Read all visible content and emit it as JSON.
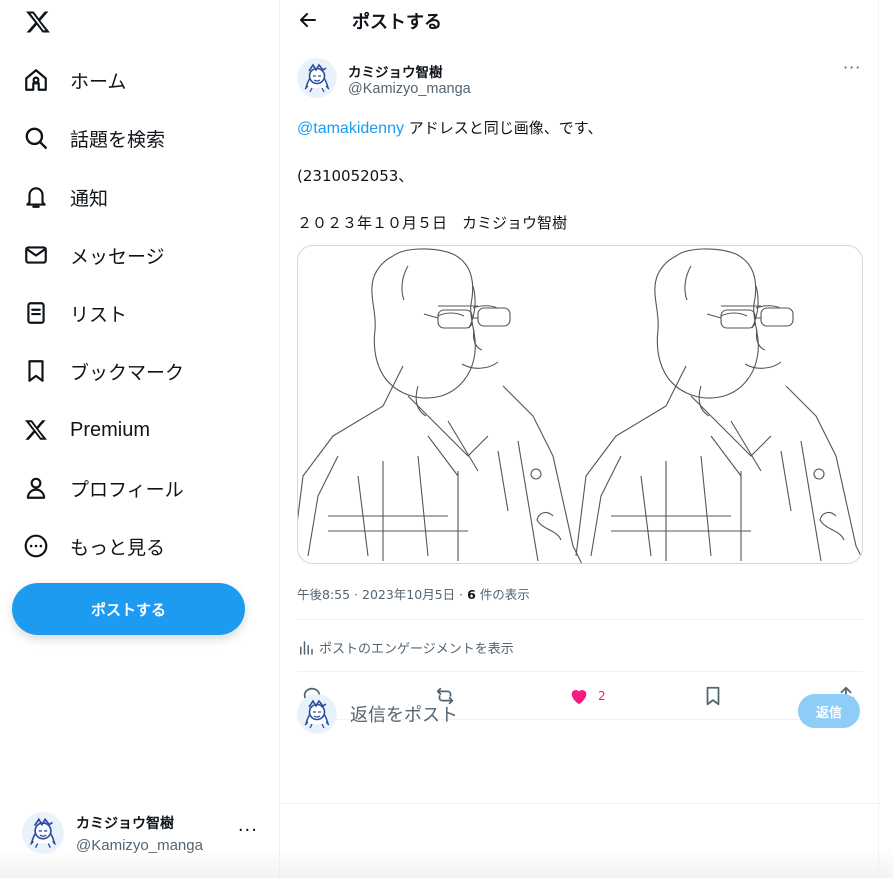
{
  "sidebar": {
    "logo_icon": "x-logo-icon",
    "items": [
      {
        "label": "ホーム",
        "icon": "home-icon"
      },
      {
        "label": "話題を検索",
        "icon": "search-icon"
      },
      {
        "label": "通知",
        "icon": "bell-icon"
      },
      {
        "label": "メッセージ",
        "icon": "envelope-icon"
      },
      {
        "label": "リスト",
        "icon": "list-icon"
      },
      {
        "label": "ブックマーク",
        "icon": "bookmark-icon"
      },
      {
        "label": "Premium",
        "icon": "x-logo-icon"
      },
      {
        "label": "プロフィール",
        "icon": "person-icon"
      },
      {
        "label": "もっと見る",
        "icon": "more-circle-icon"
      }
    ],
    "post_button_label": "ポストする",
    "account": {
      "display_name": "カミジョウ智樹",
      "handle": "@Kamizyo_manga",
      "more": "···"
    }
  },
  "header": {
    "title": "ポストする",
    "back_icon": "arrow-left-icon"
  },
  "post": {
    "author_name": "カミジョウ智樹",
    "author_handle": "@Kamizyo_manga",
    "more": "···",
    "mention": "@tamakidenny",
    "line1_rest": " アドレスと同じ画像、です、",
    "line2": "(2310052053、",
    "line3": "２０２３年１０月５日　カミジョウ智樹",
    "time": "午後8:55 · 2023年10月5日 · ",
    "views_count": "6",
    "views_label": " 件の表示",
    "engagement_label": "ポストのエンゲージメントを表示",
    "like_count": "2"
  },
  "reply": {
    "placeholder": "返信をポスト",
    "button_label": "返信"
  },
  "colors": {
    "accent": "#1d9bf0",
    "like": "#f91880",
    "muted": "#536471"
  }
}
